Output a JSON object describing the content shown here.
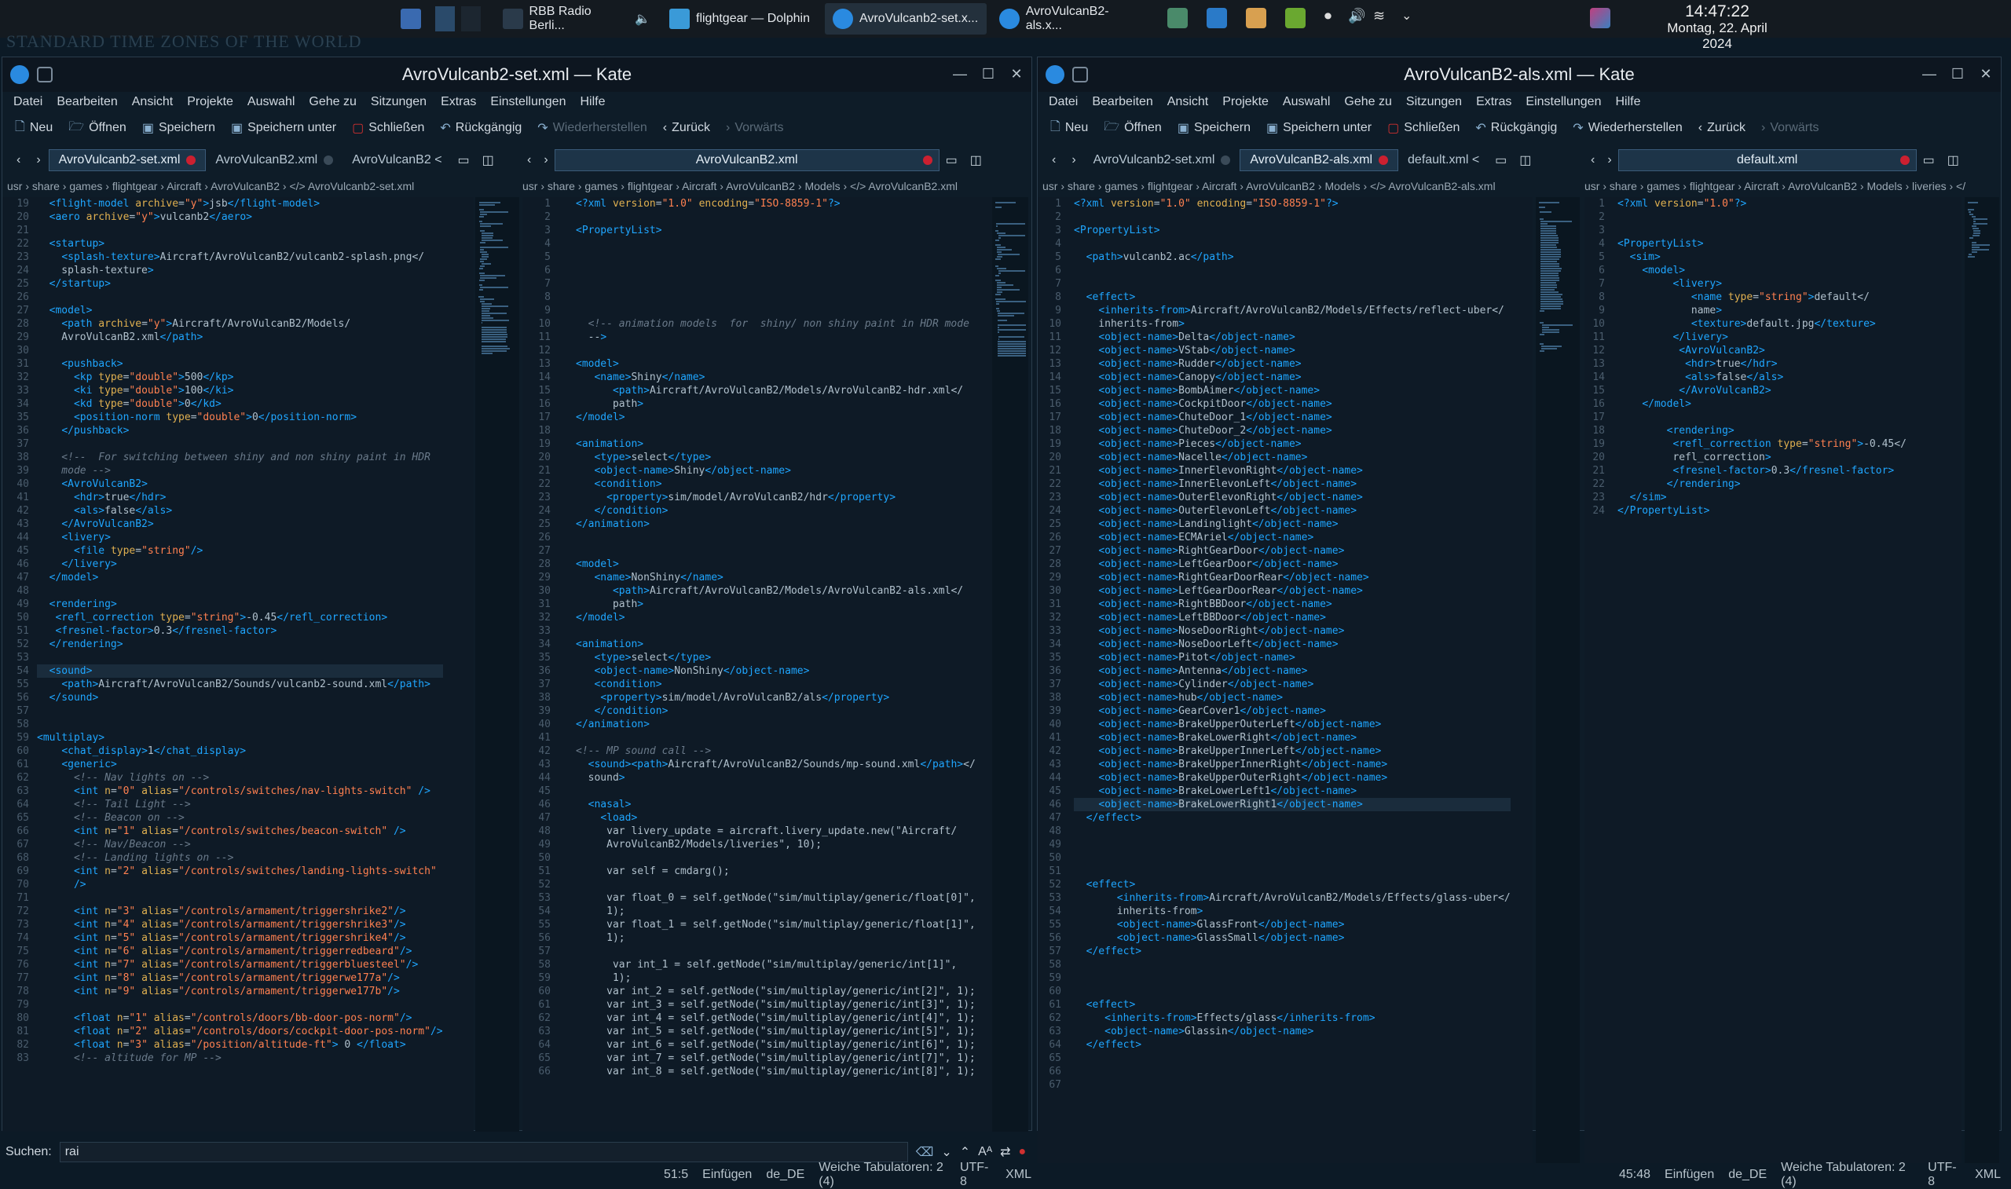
{
  "taskbar": {
    "items": [
      {
        "label": "RBB Radio Berli...",
        "name": "taskbar-rbb-radio"
      },
      {
        "label": "flightgear — Dolphin",
        "name": "taskbar-dolphin"
      },
      {
        "label": "AvroVulcanb2-set.x...",
        "name": "taskbar-kate-1"
      },
      {
        "label": "AvroVulcanB2-als.x...",
        "name": "taskbar-kate-2"
      }
    ],
    "time": "14:47:22",
    "date": "Montag, 22. April 2024"
  },
  "desktop_text": "STANDARD TIME ZONES OF THE WORLD",
  "menu": [
    "Datei",
    "Bearbeiten",
    "Ansicht",
    "Projekte",
    "Auswahl",
    "Gehe zu",
    "Sitzungen",
    "Extras",
    "Einstellungen",
    "Hilfe"
  ],
  "toolbar": {
    "neu": "Neu",
    "oeffnen": "Öffnen",
    "speichern": "Speichern",
    "speichern_unter": "Speichern unter",
    "schliessen": "Schließen",
    "rueckgaengig": "Rückgängig",
    "wiederherstellen": "Wiederherstellen",
    "zurueck": "Zurück",
    "vorwaerts": "Vorwärts"
  },
  "win1": {
    "title": "AvroVulcanb2-set.xml — Kate",
    "tabs_left": [
      "AvroVulcanb2-set.xml",
      "AvroVulcanB2.xml",
      "AvroVulcanB2 <"
    ],
    "tabs_right": [
      "AvroVulcanB2.xml"
    ],
    "crumb_left": "usr › share › games › flightgear › Aircraft › AvroVulcanB2 › </> AvroVulcanb2-set.xml",
    "crumb_right": "usr › share › games › flightgear › Aircraft › AvroVulcanB2 › Models › </> AvroVulcanB2.xml",
    "search_label": "Suchen:",
    "search_value": "rai",
    "status": [
      "51:5",
      "Einfügen",
      "de_DE",
      "Weiche Tabulatoren: 2 (4)",
      "UTF-8",
      "XML"
    ]
  },
  "win2": {
    "title": "AvroVulcanB2-als.xml — Kate",
    "tabs_left": [
      "AvroVulcanb2-set.xml",
      "AvroVulcanB2-als.xml",
      "default.xml <"
    ],
    "tabs_right": [
      "default.xml"
    ],
    "crumb_left": "usr › share › games › flightgear › Aircraft › AvroVulcanB2 › Models › </> AvroVulcanB2-als.xml",
    "crumb_right": "usr › share › games › flightgear › Aircraft › AvroVulcanB2 › Models › liveries › </",
    "status": [
      "45:48",
      "Einfügen",
      "de_DE",
      "Weiche Tabulatoren: 2 (4)",
      "UTF-8",
      "XML"
    ]
  },
  "code1": {
    "start": 19,
    "lines": [
      "  <flight-model archive=\"y\">jsb</flight-model>",
      "  <aero archive=\"y\">vulcanb2</aero>",
      "",
      "  <startup>",
      "    <splash-texture>Aircraft/AvroVulcanB2/vulcanb2-splash.png</",
      "    splash-texture>",
      "  </startup>",
      "",
      "  <model>",
      "    <path archive=\"y\">Aircraft/AvroVulcanB2/Models/",
      "    AvroVulcanB2.xml</path>",
      "",
      "    <pushback>",
      "      <kp type=\"double\">500</kp>",
      "      <ki type=\"double\">100</ki>",
      "      <kd type=\"double\">0</kd>",
      "      <position-norm type=\"double\">0</position-norm>",
      "    </pushback>",
      "",
      "    <!--  For switching between shiny and non shiny paint in HDR",
      "    mode -->",
      "    <AvroVulcanB2>",
      "      <hdr>true</hdr>",
      "      <als>false</als>",
      "    </AvroVulcanB2>",
      "    <livery>",
      "      <file type=\"string\"/>",
      "    </livery>",
      "  </model>",
      "",
      "  <rendering>",
      "   <refl_correction type=\"string\">-0.45</refl_correction>",
      "   <fresnel-factor>0.3</fresnel-factor>",
      "  </rendering>",
      "",
      "  <sound>",
      "    <path>Aircraft/AvroVulcanB2/Sounds/vulcanb2-sound.xml</path>",
      "  </sound>",
      "",
      "",
      "<multiplay>",
      "    <chat_display>1</chat_display>",
      "    <generic>",
      "      <!-- Nav lights on -->",
      "      <int n=\"0\" alias=\"/controls/switches/nav-lights-switch\" />",
      "      <!-- Tail Light -->",
      "      <!-- Beacon on -->",
      "      <int n=\"1\" alias=\"/controls/switches/beacon-switch\" />",
      "      <!-- Nav/Beacon -->",
      "      <!-- Landing lights on -->",
      "      <int n=\"2\" alias=\"/controls/switches/landing-lights-switch\"",
      "      />",
      "",
      "      <int n=\"3\" alias=\"/controls/armament/triggershrike2\"/>",
      "      <int n=\"4\" alias=\"/controls/armament/triggershrike3\"/>",
      "      <int n=\"5\" alias=\"/controls/armament/triggershrike4\"/>",
      "      <int n=\"6\" alias=\"/controls/armament/triggerredbeard\"/>",
      "      <int n=\"7\" alias=\"/controls/armament/triggerbluesteel\"/>",
      "      <int n=\"8\" alias=\"/controls/armament/triggerwe177a\"/>",
      "      <int n=\"9\" alias=\"/controls/armament/triggerwe177b\"/>",
      "",
      "      <float n=\"1\" alias=\"/controls/doors/bb-door-pos-norm\"/>",
      "      <float n=\"2\" alias=\"/controls/doors/cockpit-door-pos-norm\"/>",
      "      <float n=\"3\" alias=\"/position/altitude-ft\"> 0 </float>",
      "      <!-- altitude for MP -->"
    ]
  },
  "code2": {
    "start": 1,
    "lines": [
      "<?xml version=\"1.0\" encoding=\"ISO-8859-1\"?>",
      "",
      "<PropertyList>",
      "",
      "",
      "",
      "",
      "",
      "",
      "  <!-- animation models  for  shiny/ non shiny paint in HDR mode",
      "  -->",
      "",
      "<model>",
      "   <name>Shiny</name>",
      "      <path>Aircraft/AvroVulcanB2/Models/AvroVulcanB2-hdr.xml</",
      "      path>",
      "</model>",
      "",
      "<animation>",
      "   <type>select</type>",
      "   <object-name>Shiny</object-name>",
      "   <condition>",
      "     <property>sim/model/AvroVulcanB2/hdr</property>",
      "   </condition>",
      "</animation>",
      "",
      "",
      "<model>",
      "   <name>NonShiny</name>",
      "      <path>Aircraft/AvroVulcanB2/Models/AvroVulcanB2-als.xml</",
      "      path>",
      "</model>",
      "",
      "<animation>",
      "   <type>select</type>",
      "   <object-name>NonShiny</object-name>",
      "   <condition>",
      "    <property>sim/model/AvroVulcanB2/als</property>",
      "   </condition>",
      "</animation>",
      "",
      "<!-- MP sound call -->",
      "  <sound><path>Aircraft/AvroVulcanB2/Sounds/mp-sound.xml</path></",
      "  sound>",
      "",
      "  <nasal>",
      "    <load>",
      "     var livery_update = aircraft.livery_update.new(\"Aircraft/",
      "     AvroVulcanB2/Models/liveries\", 10);",
      "",
      "     var self = cmdarg();",
      "",
      "     var float_0 = self.getNode(\"sim/multiplay/generic/float[0]\",",
      "     1);",
      "     var float_1 = self.getNode(\"sim/multiplay/generic/float[1]\",",
      "     1);",
      "",
      "      var int_1 = self.getNode(\"sim/multiplay/generic/int[1]\",",
      "      1);",
      "     var int_2 = self.getNode(\"sim/multiplay/generic/int[2]\", 1);",
      "     var int_3 = self.getNode(\"sim/multiplay/generic/int[3]\", 1);",
      "     var int_4 = self.getNode(\"sim/multiplay/generic/int[4]\", 1);",
      "     var int_5 = self.getNode(\"sim/multiplay/generic/int[5]\", 1);",
      "     var int_6 = self.getNode(\"sim/multiplay/generic/int[6]\", 1);",
      "     var int_7 = self.getNode(\"sim/multiplay/generic/int[7]\", 1);",
      "     var int_8 = self.getNode(\"sim/multiplay/generic/int[8]\", 1);"
    ]
  },
  "code3": {
    "start": 1,
    "lines": [
      "<?xml version=\"1.0\" encoding=\"ISO-8859-1\"?>",
      "",
      "<PropertyList>",
      "",
      "  <path>vulcanb2.ac</path>",
      "",
      "",
      "  <effect>",
      "    <inherits-from>Aircraft/AvroVulcanB2/Models/Effects/reflect-uber</",
      "    inherits-from>",
      "    <object-name>Delta</object-name>",
      "    <object-name>VStab</object-name>",
      "    <object-name>Rudder</object-name>",
      "    <object-name>Canopy</object-name>",
      "    <object-name>BombAimer</object-name>",
      "    <object-name>CockpitDoor</object-name>",
      "    <object-name>ChuteDoor_1</object-name>",
      "    <object-name>ChuteDoor_2</object-name>",
      "    <object-name>Pieces</object-name>",
      "    <object-name>Nacelle</object-name>",
      "    <object-name>InnerElevonRight</object-name>",
      "    <object-name>InnerElevonLeft</object-name>",
      "    <object-name>OuterElevonRight</object-name>",
      "    <object-name>OuterElevonLeft</object-name>",
      "    <object-name>Landinglight</object-name>",
      "    <object-name>ECMAriel</object-name>",
      "    <object-name>RightGearDoor</object-name>",
      "    <object-name>LeftGearDoor</object-name>",
      "    <object-name>RightGearDoorRear</object-name>",
      "    <object-name>LeftGearDoorRear</object-name>",
      "    <object-name>RightBBDoor</object-name>",
      "    <object-name>LeftBBDoor</object-name>",
      "    <object-name>NoseDoorRight</object-name>",
      "    <object-name>NoseDoorLeft</object-name>",
      "    <object-name>Pitot</object-name>",
      "    <object-name>Antenna</object-name>",
      "    <object-name>Cylinder</object-name>",
      "    <object-name>hub</object-name>",
      "    <object-name>GearCover1</object-name>",
      "    <object-name>BrakeUpperOuterLeft</object-name>",
      "    <object-name>BrakeLowerRight</object-name>",
      "    <object-name>BrakeUpperInnerLeft</object-name>",
      "    <object-name>BrakeUpperInnerRight</object-name>",
      "    <object-name>BrakeUpperOuterRight</object-name>",
      "    <object-name>BrakeLowerLeft1</object-name>",
      "    <object-name>BrakeLowerRight1</object-name>",
      "  </effect>",
      "",
      "",
      "",
      "",
      "  <effect>",
      "       <inherits-from>Aircraft/AvroVulcanB2/Models/Effects/glass-uber</",
      "       inherits-from>",
      "       <object-name>GlassFront</object-name>",
      "       <object-name>GlassSmall</object-name>",
      "  </effect>",
      "",
      "",
      "",
      "  <effect>",
      "     <inherits-from>Effects/glass</inherits-from>",
      "     <object-name>Glassin</object-name>",
      "  </effect>",
      "",
      "",
      ""
    ]
  },
  "code4": {
    "start": 1,
    "lines": [
      "<?xml version=\"1.0\"?>",
      "",
      "",
      "<PropertyList>",
      "  <sim>",
      "    <model>",
      "         <livery>",
      "            <name type=\"string\">default</",
      "            name>",
      "            <texture>default.jpg</texture>",
      "         </livery>",
      "          <AvroVulcanB2>",
      "           <hdr>true</hdr>",
      "           <als>false</als>",
      "          </AvroVulcanB2>",
      "    </model>",
      "",
      "        <rendering>",
      "         <refl_correction type=\"string\">-0.45</",
      "         refl_correction>",
      "         <fresnel-factor>0.3</fresnel-factor>",
      "        </rendering>",
      "  </sim>",
      "</PropertyList>"
    ]
  },
  "colors": {
    "accent": "#1fa6ff",
    "attr": "#e0b050",
    "string": "#ff8050",
    "background": "#0e1a26"
  }
}
